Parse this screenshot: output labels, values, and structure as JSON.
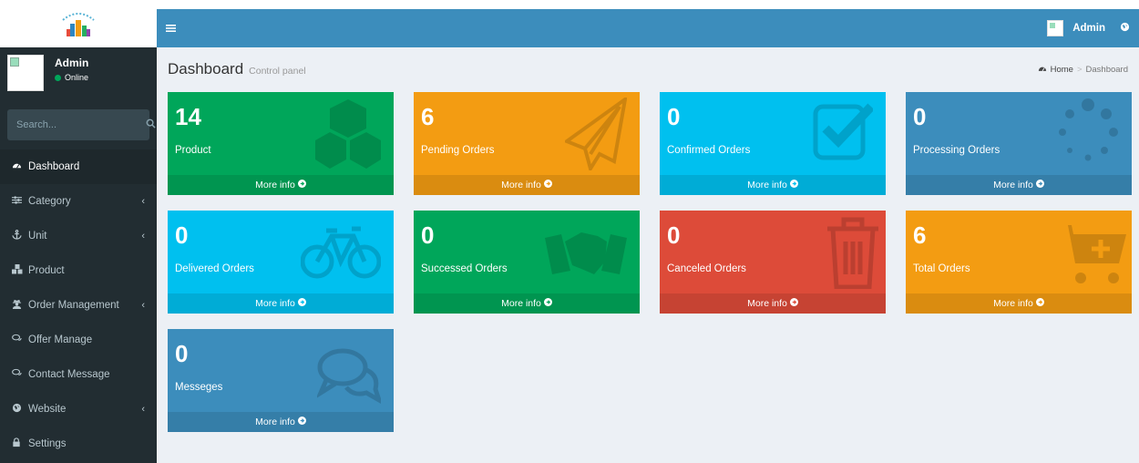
{
  "sidebar": {
    "user": {
      "name": "Admin",
      "status": "Online"
    },
    "search_placeholder": "Search...",
    "items": [
      {
        "label": "Dashboard",
        "icon": "dashboard-icon",
        "active": true,
        "has_submenu": false
      },
      {
        "label": "Category",
        "icon": "sliders-icon",
        "active": false,
        "has_submenu": true
      },
      {
        "label": "Unit",
        "icon": "anchor-icon",
        "active": false,
        "has_submenu": true
      },
      {
        "label": "Product",
        "icon": "cubes-icon",
        "active": false,
        "has_submenu": false
      },
      {
        "label": "Order Management",
        "icon": "user-secret-icon",
        "active": false,
        "has_submenu": true
      },
      {
        "label": "Offer Manage",
        "icon": "comments-icon",
        "active": false,
        "has_submenu": false
      },
      {
        "label": "Contact Message",
        "icon": "comments-icon",
        "active": false,
        "has_submenu": false
      },
      {
        "label": "Website",
        "icon": "globe-icon",
        "active": false,
        "has_submenu": true
      },
      {
        "label": "Settings",
        "icon": "lock-icon",
        "active": false,
        "has_submenu": false
      }
    ]
  },
  "header": {
    "toggle_icon": "hamburger-icon",
    "user_name": "Admin"
  },
  "page": {
    "title": "Dashboard",
    "subtitle": "Control panel",
    "breadcrumb": {
      "home": "Home",
      "current": "Dashboard"
    }
  },
  "boxes": [
    {
      "value": "14",
      "label": "Product",
      "color": "#00a65a",
      "icon": "cubes-icon",
      "footer": "More info"
    },
    {
      "value": "6",
      "label": "Pending Orders",
      "color": "#f39c12",
      "icon": "paper-plane-icon",
      "footer": "More info"
    },
    {
      "value": "0",
      "label": "Confirmed Orders",
      "color": "#00c0ef",
      "icon": "check-square-icon",
      "footer": "More info"
    },
    {
      "value": "0",
      "label": "Processing Orders",
      "color": "#3c8dbc",
      "icon": "spinner-icon",
      "footer": "More info"
    },
    {
      "value": "0",
      "label": "Delivered Orders",
      "color": "#00c0ef",
      "icon": "bicycle-icon",
      "footer": "More info"
    },
    {
      "value": "0",
      "label": "Successed Orders",
      "color": "#00a65a",
      "icon": "handshake-icon",
      "footer": "More info"
    },
    {
      "value": "0",
      "label": "Canceled Orders",
      "color": "#dd4b39",
      "icon": "trash-icon",
      "footer": "More info"
    },
    {
      "value": "6",
      "label": "Total Orders",
      "color": "#f39c12",
      "icon": "cart-plus-icon",
      "footer": "More info"
    },
    {
      "value": "0",
      "label": "Messeges",
      "color": "#3c8dbc",
      "icon": "comments-icon",
      "footer": "More info"
    }
  ]
}
